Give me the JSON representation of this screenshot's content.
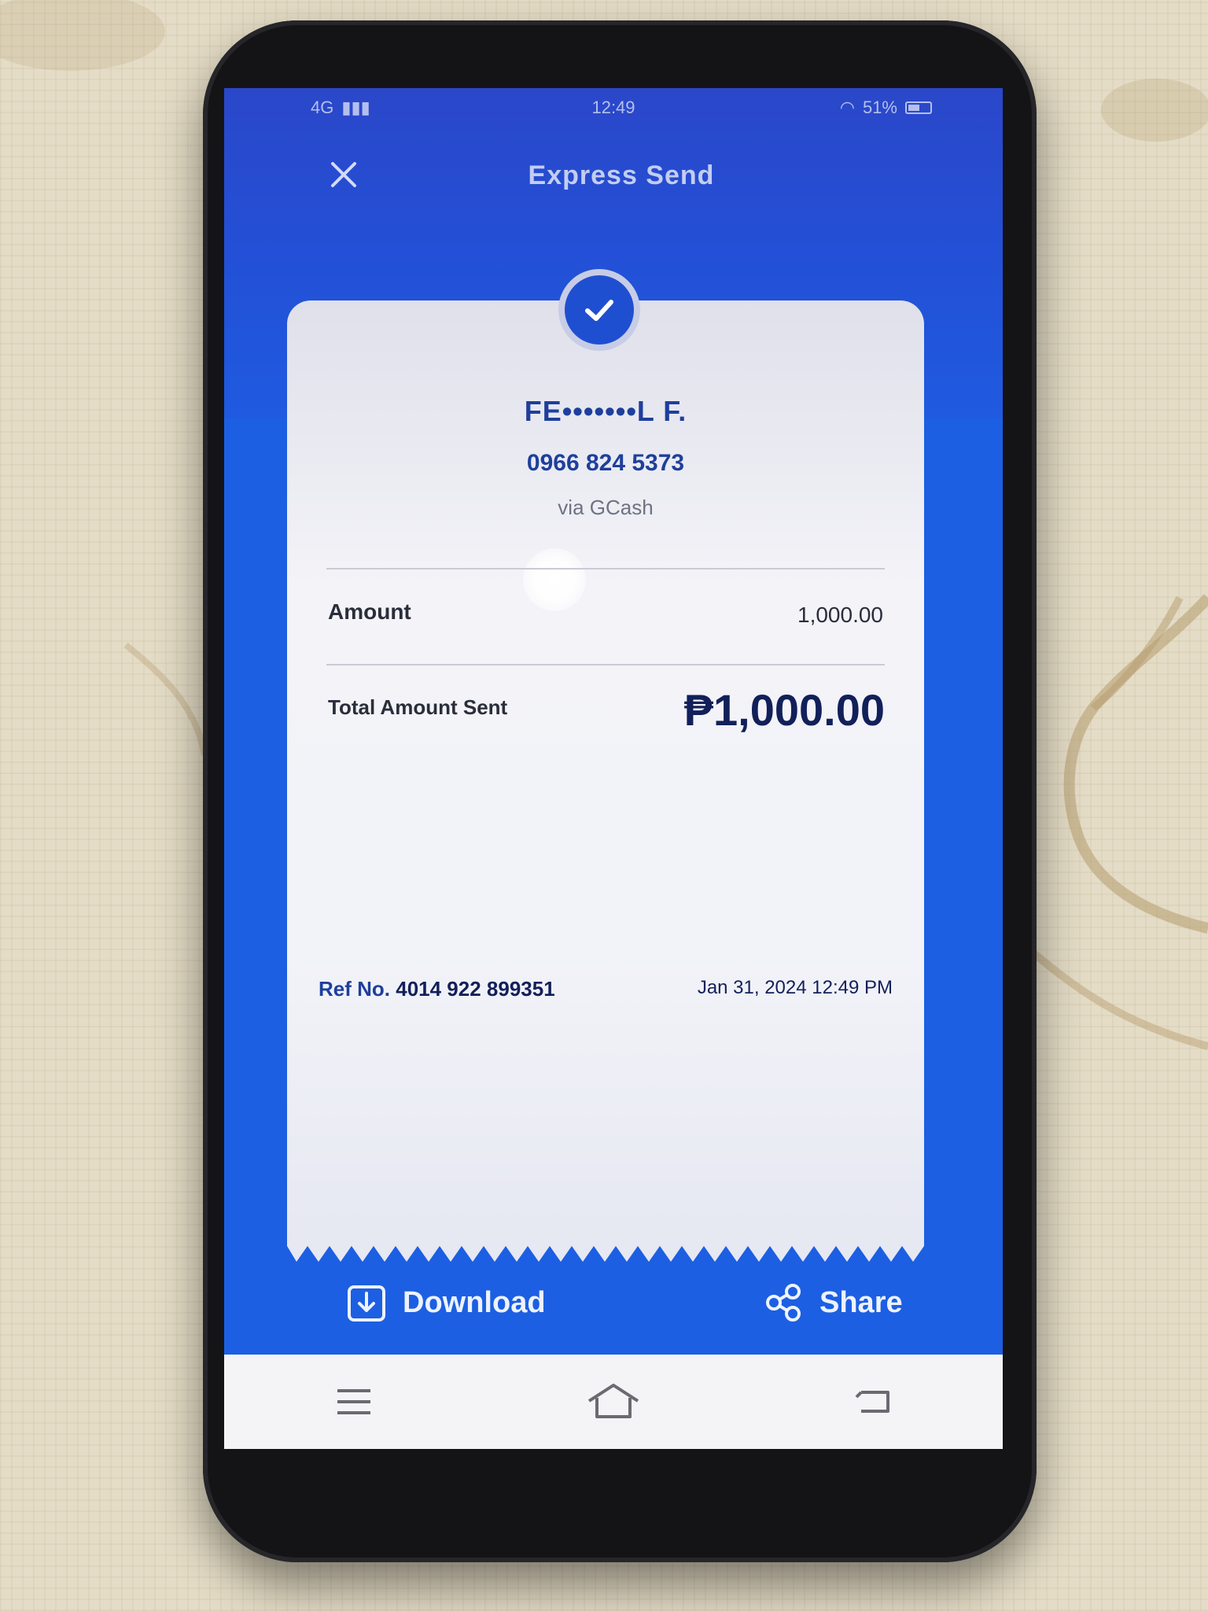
{
  "statusbar": {
    "network": "4G",
    "time": "12:49",
    "battery": "51%"
  },
  "appbar": {
    "title": "Express Send",
    "close_icon": "close-icon"
  },
  "receipt": {
    "recipient_name": "FE•••••••L F.",
    "recipient_number": "0966 824 5373",
    "recipient_via": "via GCash",
    "amount_label": "Amount",
    "amount_value": "1,000.00",
    "total_label": "Total Amount Sent",
    "total_value": "₱1,000.00",
    "ref_label": "Ref No.",
    "ref_number": "4014 922 899351",
    "datetime": "Jan 31, 2024 12:49 PM"
  },
  "actions": {
    "download_label": "Download",
    "share_label": "Share"
  },
  "navbar": {
    "items": [
      "menu-icon",
      "home-icon",
      "back-icon"
    ]
  },
  "colors": {
    "brand_blue": "#1c5fe3",
    "header_blue": "#2b47c9",
    "text_navy": "#12205a"
  }
}
